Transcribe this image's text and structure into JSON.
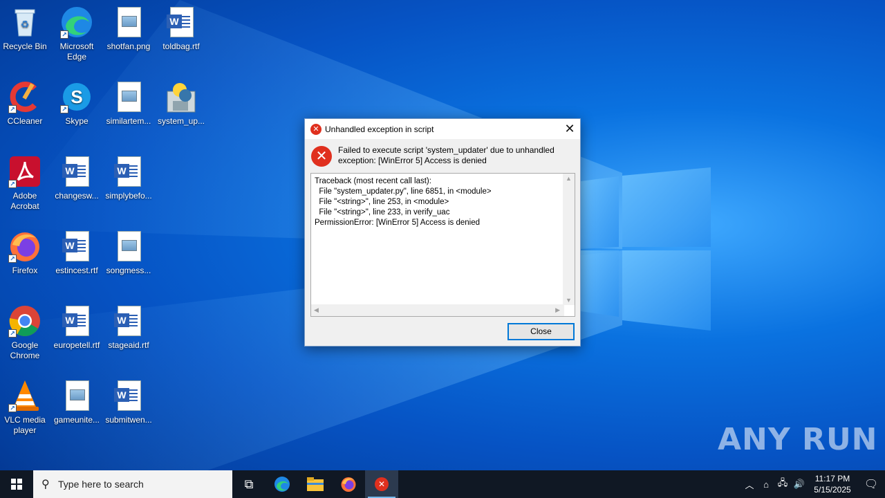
{
  "desktop": {
    "icons": [
      {
        "label": "Recycle Bin",
        "icon": "recycle-bin-icon"
      },
      {
        "label": "Microsoft Edge",
        "icon": "edge-icon"
      },
      {
        "label": "shotfan.png",
        "icon": "image-file-icon"
      },
      {
        "label": "toldbag.rtf",
        "icon": "word-doc-icon"
      },
      {
        "label": "CCleaner",
        "icon": "ccleaner-icon"
      },
      {
        "label": "Skype",
        "icon": "skype-icon"
      },
      {
        "label": "similartem...",
        "icon": "image-file-icon"
      },
      {
        "label": "system_up...",
        "icon": "python-installer-icon"
      },
      {
        "label": "Adobe Acrobat",
        "icon": "acrobat-icon"
      },
      {
        "label": "changesw...",
        "icon": "word-doc-icon"
      },
      {
        "label": "simplybefo...",
        "icon": "word-doc-icon"
      },
      {
        "label": "Firefox",
        "icon": "firefox-icon"
      },
      {
        "label": "estincest.rtf",
        "icon": "word-doc-icon"
      },
      {
        "label": "songmess...",
        "icon": "image-file-icon"
      },
      {
        "label": "Google Chrome",
        "icon": "chrome-icon"
      },
      {
        "label": "europetell.rtf",
        "icon": "word-doc-icon"
      },
      {
        "label": "stageaid.rtf",
        "icon": "word-doc-icon"
      },
      {
        "label": "VLC media player",
        "icon": "vlc-icon"
      },
      {
        "label": "gameunite...",
        "icon": "image-file-icon"
      },
      {
        "label": "submitwen...",
        "icon": "word-doc-icon"
      }
    ]
  },
  "dialog": {
    "title": "Unhandled exception in script",
    "message": "Failed to execute script 'system_updater' due to unhandled exception: [WinError 5] Access is denied",
    "traceback": "Traceback (most recent call last):\n  File \"system_updater.py\", line 6851, in <module>\n  File \"<string>\", line 253, in <module>\n  File \"<string>\", line 233, in verify_uac\nPermissionError: [WinError 5] Access is denied",
    "close_label": "Close"
  },
  "watermark": "ANY RUN",
  "taskbar": {
    "search_placeholder": "Type here to search",
    "time": "11:17 PM",
    "date": "5/15/2025",
    "pinned": [
      "task-view-icon",
      "edge-icon",
      "file-explorer-icon",
      "firefox-icon",
      "error-app-icon"
    ]
  },
  "colors": {
    "error_red": "#e0301e",
    "accent": "#0078d7",
    "taskbar": "#101824"
  }
}
